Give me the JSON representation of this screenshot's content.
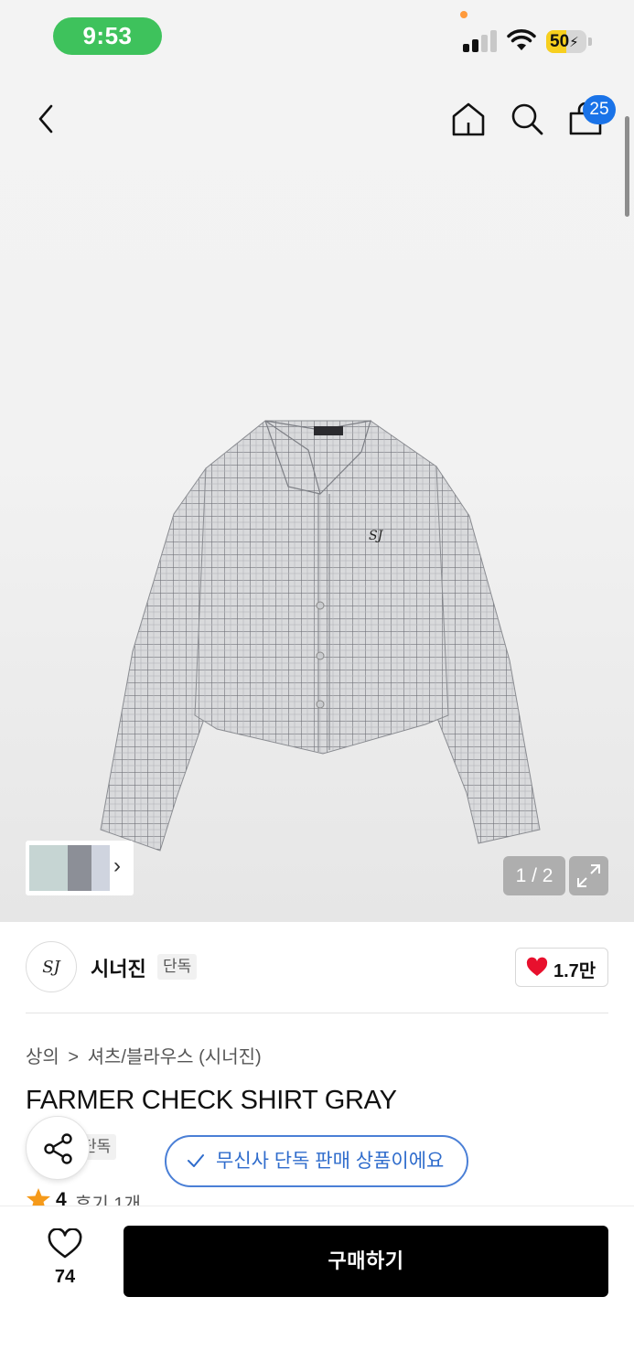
{
  "status_bar": {
    "time": "9:53",
    "battery_level": "50",
    "icons": [
      "signal-icon",
      "wifi-icon",
      "battery-icon"
    ]
  },
  "top_nav": {
    "icons": [
      "back-icon",
      "home-icon",
      "search-icon",
      "cart-icon"
    ],
    "cart_count": "25"
  },
  "gallery": {
    "pager": "1 / 2",
    "icons": [
      "chevron-right-icon",
      "expand-icon"
    ]
  },
  "brand": {
    "logo_text": "SJ",
    "name": "시너진",
    "tag": "단독",
    "like_count": "1.7만"
  },
  "breadcrumb": {
    "category": "상의",
    "separator": ">",
    "subcategory": "셔츠/블라우스 (시너진)"
  },
  "product": {
    "title": "FARMER CHECK SHIRT GRAY",
    "tag": "단독",
    "exclusive_notice": "무신사 단독 판매 상품이에요",
    "rating": "4",
    "reviews": "후기 1개"
  },
  "bottom_bar": {
    "wish_count": "74",
    "buy_label": "구매하기"
  },
  "colors": {
    "status_time_pill": "#3ec25c",
    "cart_badge": "#1a73e8",
    "exclusive_accent": "#2f6ccc",
    "like_heart": "#e8102d",
    "star": "#f59a1a",
    "buy_button": "#000000"
  }
}
